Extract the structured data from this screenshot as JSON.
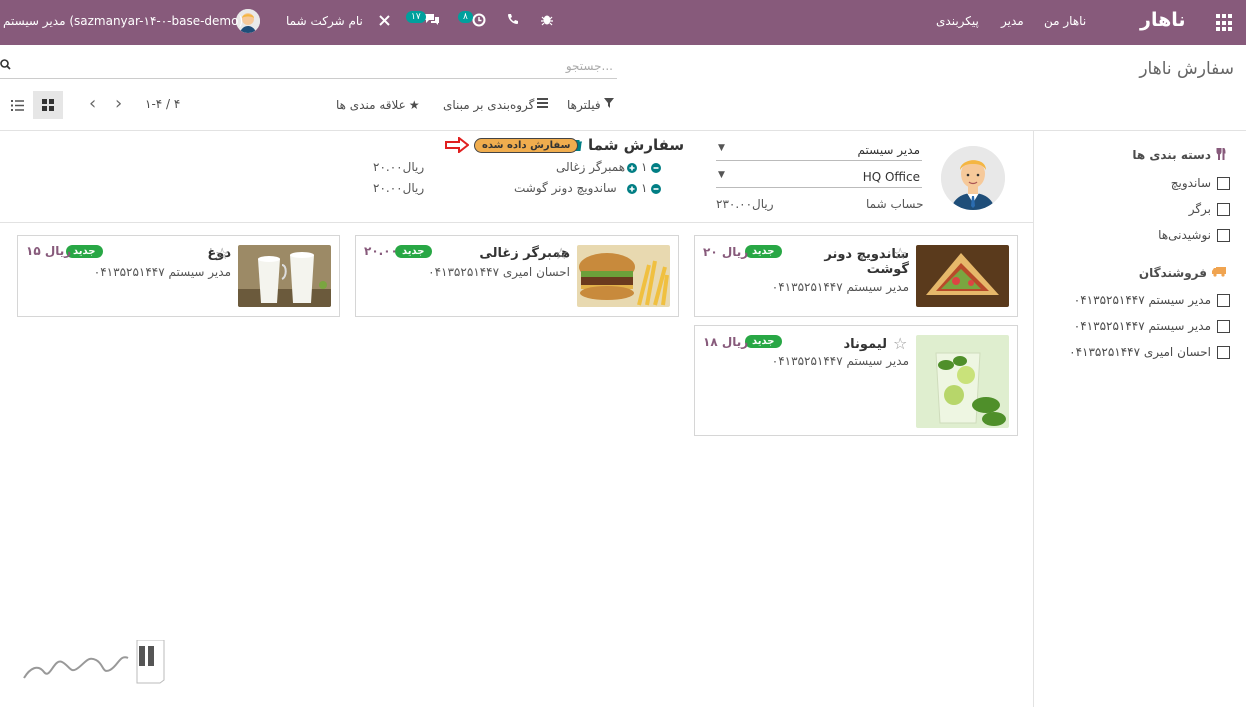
{
  "topbar": {
    "brand": "ناهار",
    "menu": [
      "ناهار من",
      "مدیر",
      "پیکربندی"
    ],
    "company": "نام شرکت شما",
    "user": "مدیر سیستم (sazmanyar-۱۴-۰-base-demo)",
    "messages_count": "۱۷",
    "activities_count": "۸",
    "colors": {
      "bar": "#875a7b",
      "badge": "#00a09d"
    }
  },
  "control_panel": {
    "title": "سفارش ناهار",
    "search_placeholder": "جستجو...",
    "filters": "فیلترها",
    "group_by": "گروه‌بندی بر مبنای",
    "favorites": "علاقه مندی ها",
    "pager": "۱-۴ / ۴"
  },
  "sidebar": {
    "categories_title": "دسته بندی ها",
    "categories": [
      "ساندویچ",
      "برگر",
      "نوشیدنی‌ها"
    ],
    "vendors_title": "فروشندگان",
    "vendors": [
      "مدیر سیستم ۰۴۱۳۵۲۵۱۴۴۷",
      "مدیر سیستم ۰۴۱۳۵۲۵۱۴۴۷",
      "احسان امیری ۰۴۱۳۵۲۵۱۴۴۷"
    ]
  },
  "cart": {
    "user": "مدیر سیستم",
    "location": "HQ Office",
    "account_label": "حساب شما",
    "account_value": "۲۳۰.۰۰ریال",
    "title": "سفارش شما",
    "status": "سفارش داده شده",
    "lines": [
      {
        "qty": "۱",
        "name": "همبرگر زغالی",
        "price": "۲۰.۰۰ریال"
      },
      {
        "qty": "۱",
        "name": "ساندویچ دونر گوشت",
        "price": "۲۰.۰۰ریال"
      }
    ]
  },
  "products": [
    {
      "name": "ساندویچ دونر گوشت",
      "badge": "جدید",
      "price": "۲۰ ریال",
      "vendor": "مدیر سیستم ۰۴۱۳۵۲۵۱۴۴۷"
    },
    {
      "name": "همبرگر زغالی",
      "badge": "جدید",
      "price": "۲۰.۰۰",
      "vendor": "احسان امیری ۰۴۱۳۵۲۵۱۴۴۷"
    },
    {
      "name": "دوغ",
      "badge": "جدید",
      "price": "۱۵ ریال",
      "vendor": "مدیر سیستم ۰۴۱۳۵۲۵۱۴۴۷"
    },
    {
      "name": "لیموناد",
      "badge": "جدید",
      "price": "۱۸ ریال",
      "vendor": "مدیر سیستم ۰۴۱۳۵۲۵۱۴۴۷"
    }
  ]
}
